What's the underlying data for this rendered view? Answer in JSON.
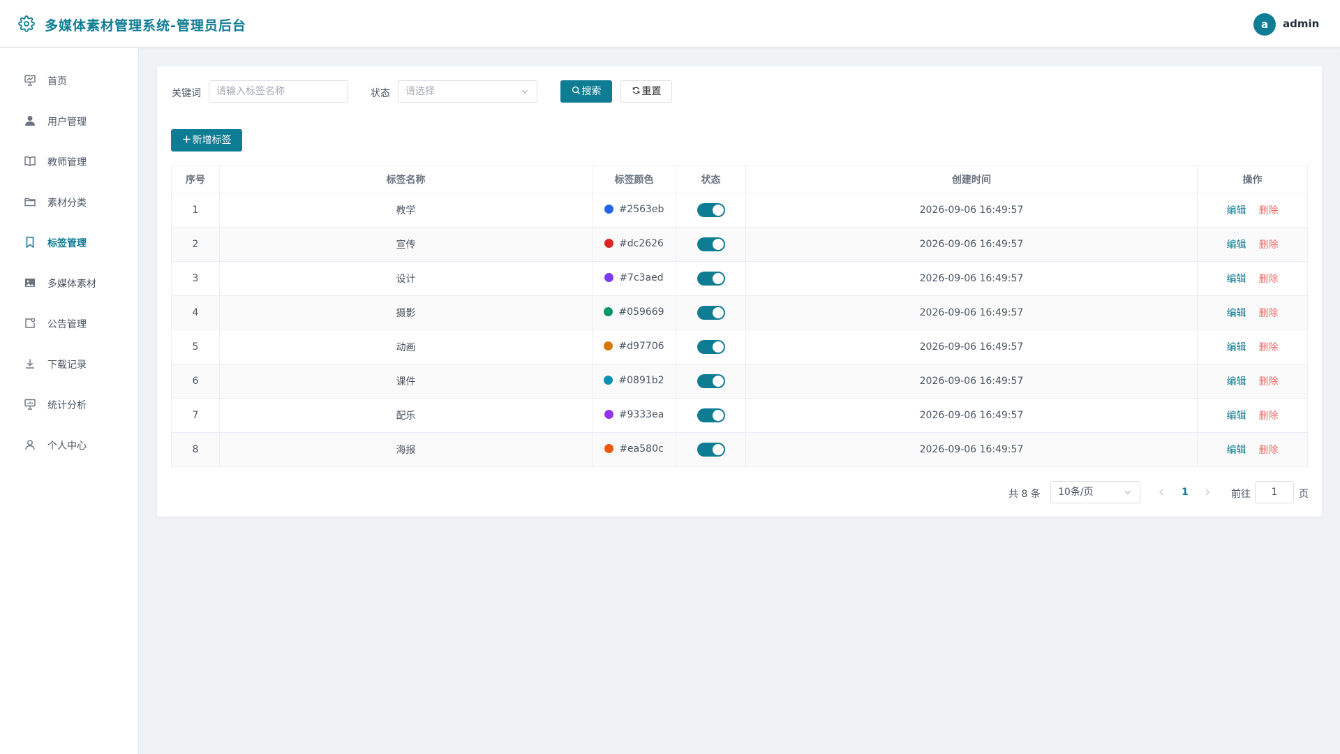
{
  "header": {
    "title": "多媒体素材管理系统-管理员后台",
    "avatar_letter": "a",
    "username": "admin"
  },
  "sidebar": {
    "active_index": 4,
    "items": [
      {
        "label": "首页",
        "icon": "presentation-icon"
      },
      {
        "label": "用户管理",
        "icon": "user-icon"
      },
      {
        "label": "教师管理",
        "icon": "book-icon"
      },
      {
        "label": "素材分类",
        "icon": "folder-icon"
      },
      {
        "label": "标签管理",
        "icon": "bookmark-icon"
      },
      {
        "label": "多媒体素材",
        "icon": "image-icon"
      },
      {
        "label": "公告管理",
        "icon": "notice-icon"
      },
      {
        "label": "下载记录",
        "icon": "download-icon"
      },
      {
        "label": "统计分析",
        "icon": "chart-icon"
      },
      {
        "label": "个人中心",
        "icon": "person-icon"
      }
    ]
  },
  "filter": {
    "keyword_label": "关键词",
    "keyword_placeholder": "请输入标签名称",
    "status_label": "状态",
    "status_placeholder": "请选择",
    "search_label": "搜索",
    "reset_label": "重置"
  },
  "add_button_label": "新增标签",
  "table": {
    "columns": [
      "序号",
      "标签名称",
      "标签颜色",
      "状态",
      "创建时间",
      "操作"
    ],
    "edit_label": "编辑",
    "delete_label": "删除",
    "rows": [
      {
        "index": "1",
        "name": "教学",
        "color": "#2563eb",
        "enabled": true,
        "created": "2026-09-06 16:49:57"
      },
      {
        "index": "2",
        "name": "宣传",
        "color": "#dc2626",
        "enabled": true,
        "created": "2026-09-06 16:49:57"
      },
      {
        "index": "3",
        "name": "设计",
        "color": "#7c3aed",
        "enabled": true,
        "created": "2026-09-06 16:49:57"
      },
      {
        "index": "4",
        "name": "摄影",
        "color": "#059669",
        "enabled": true,
        "created": "2026-09-06 16:49:57"
      },
      {
        "index": "5",
        "name": "动画",
        "color": "#d97706",
        "enabled": true,
        "created": "2026-09-06 16:49:57"
      },
      {
        "index": "6",
        "name": "课件",
        "color": "#0891b2",
        "enabled": true,
        "created": "2026-09-06 16:49:57"
      },
      {
        "index": "7",
        "name": "配乐",
        "color": "#9333ea",
        "enabled": true,
        "created": "2026-09-06 16:49:57"
      },
      {
        "index": "8",
        "name": "海报",
        "color": "#ea580c",
        "enabled": true,
        "created": "2026-09-06 16:49:57"
      }
    ]
  },
  "pagination": {
    "total_text": "共 8 条",
    "page_size": "10条/页",
    "current_page": "1",
    "goto_label": "前往",
    "goto_value": "1",
    "page_suffix": "页"
  },
  "colors": {
    "primary": "#0e7c93",
    "danger": "#f56c6c"
  }
}
